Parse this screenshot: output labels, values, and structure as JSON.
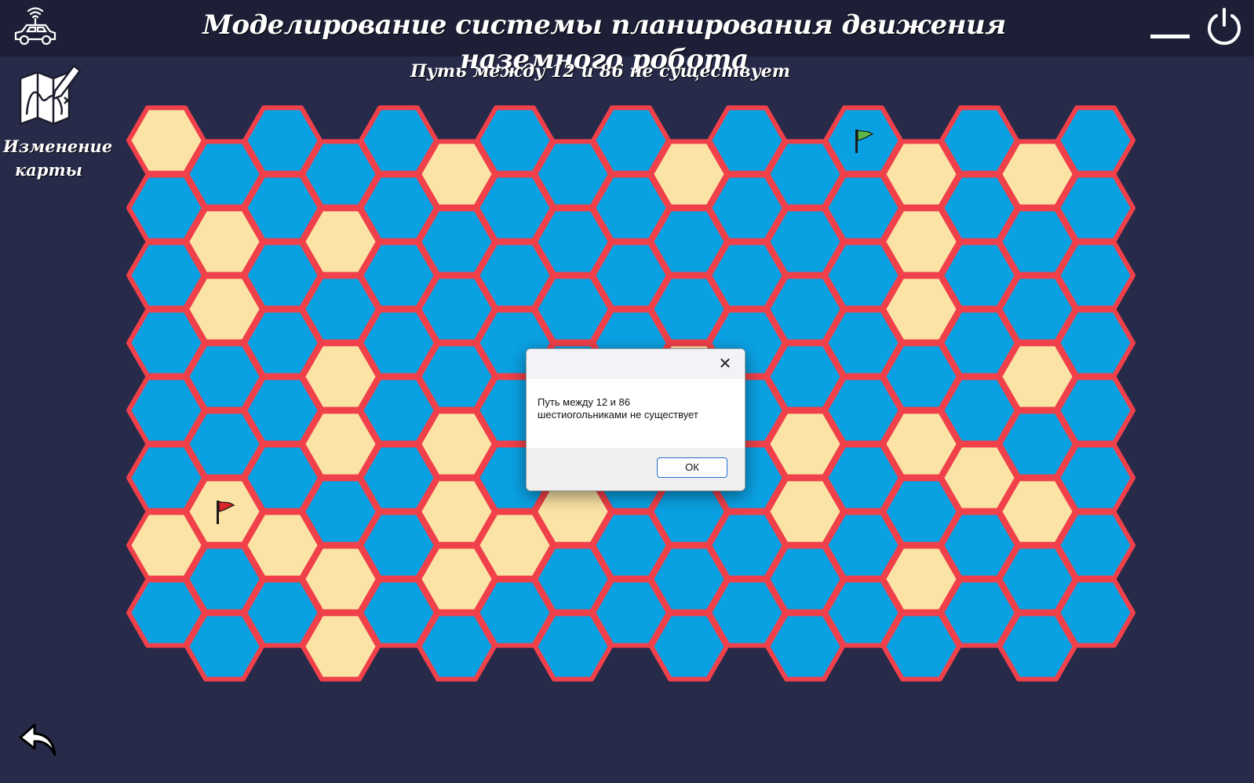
{
  "app": {
    "title": "Моделирование системы планирования движения наземного робота",
    "logo_icon": "robot-car-icon"
  },
  "window_controls": {
    "minimize_icon": "minimize-icon",
    "power_icon": "power-icon"
  },
  "status": {
    "text": "Путь между 12 и 86 не существует"
  },
  "sidebar": {
    "map_edit_label_line1": "Изменение",
    "map_edit_label_line2": "карты",
    "map_edit_icon": "map-edit-icon"
  },
  "back": {
    "icon": "back-arrow-icon"
  },
  "grid": {
    "columns": 17,
    "rows": 8,
    "colors": {
      "passable": "#0aa1e3",
      "obstacle": "#fbe3a6",
      "border": "#f0404a"
    },
    "legend_codes": {
      "B": "passable",
      "Y": "obstacle"
    },
    "cells": [
      "YBBBBYBBBYBBBYBYB",
      "BYBYBBBBBBBBBYBBB",
      "BYBBBBBBBBBBBYBBB",
      "BBBYBBBBBYBBBBBYB",
      "BBBYBYBBBYBYBYBBB",
      "BYBBBYBYBBBYBBYYB",
      "YBYYBYYBBBBBBYBBB",
      "BBBYBBBBBBBBBBBBB"
    ],
    "start_flag": {
      "color": "#5db84a",
      "icon": "green-flag-icon",
      "col": 12,
      "row": 0
    },
    "end_flag": {
      "color": "#d9262a",
      "icon": "red-flag-icon",
      "col": 1,
      "row": 5
    }
  },
  "dialog": {
    "message_line1": "Путь между 12 и 86",
    "message_line2": "шестиогольниками не существует",
    "ok_label": "ОК",
    "close_icon": "close-icon"
  }
}
